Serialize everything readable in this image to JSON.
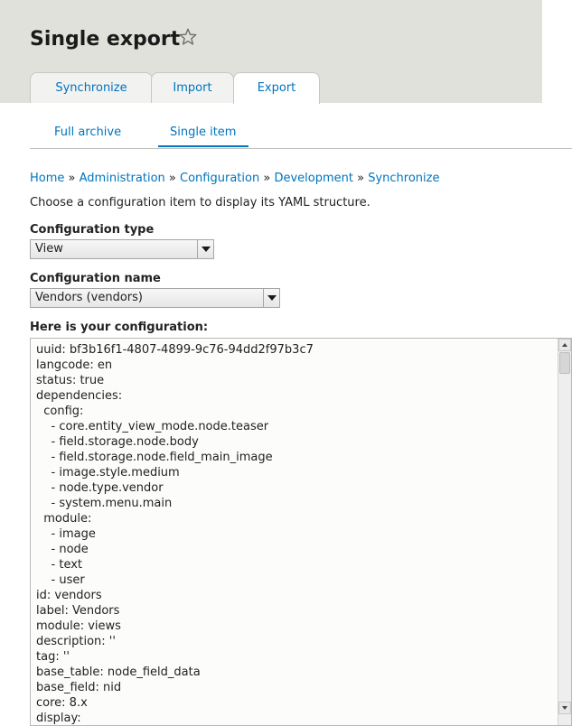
{
  "page": {
    "title": "Single export"
  },
  "primary_tabs": [
    {
      "label": "Synchronize",
      "active": false
    },
    {
      "label": "Import",
      "active": false
    },
    {
      "label": "Export",
      "active": true
    }
  ],
  "secondary_tabs": [
    {
      "label": "Full archive",
      "active": false
    },
    {
      "label": "Single item",
      "active": true
    }
  ],
  "breadcrumb": {
    "items": [
      "Home",
      "Administration",
      "Configuration",
      "Development",
      "Synchronize"
    ],
    "separator": "»"
  },
  "description": "Choose a configuration item to display its YAML structure.",
  "config_type": {
    "label": "Configuration type",
    "selected": "View"
  },
  "config_name": {
    "label": "Configuration name",
    "selected": "Vendors (vendors)"
  },
  "output": {
    "label": "Here is your configuration:",
    "lines": [
      "uuid: bf3b16f1-4807-4899-9c76-94dd2f97b3c7",
      "langcode: en",
      "status: true",
      "dependencies:",
      "  config:",
      "    - core.entity_view_mode.node.teaser",
      "    - field.storage.node.body",
      "    - field.storage.node.field_main_image",
      "    - image.style.medium",
      "    - node.type.vendor",
      "    - system.menu.main",
      "  module:",
      "    - image",
      "    - node",
      "    - text",
      "    - user",
      "id: vendors",
      "label: Vendors",
      "module: views",
      "description: ''",
      "tag: ''",
      "base_table: node_field_data",
      "base_field: nid",
      "core: 8.x",
      "display:"
    ]
  },
  "icons": {
    "favorite": "star-outline-icon",
    "dropdown": "chevron-down-icon"
  },
  "colors": {
    "link": "#0074bd",
    "header_bg": "#e1e1db"
  }
}
